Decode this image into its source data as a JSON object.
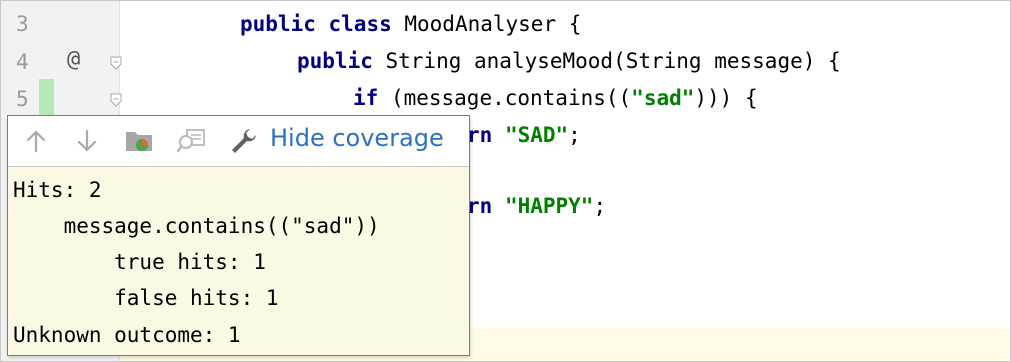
{
  "gutter": {
    "line_numbers": [
      "3",
      "4",
      "5"
    ],
    "override_icon": "@"
  },
  "code": {
    "line3": {
      "kw1": "public",
      "kw2": "class",
      "rest": " MoodAnalyser {"
    },
    "line4": {
      "kw1": "public",
      "rest": " String analyseMood(String message) {"
    },
    "line5": {
      "kw1": "if",
      "rest1": " (message.contains((",
      "str": "\"sad\"",
      "rest2": "))) {"
    },
    "line6": {
      "kw_tail": "rn",
      "str": "\"SAD\"",
      "rest": ";"
    },
    "line8": {
      "kw_tail": "rn",
      "str": "\"HAPPY\"",
      "rest": ";"
    }
  },
  "popup": {
    "toolbar": {
      "up_icon": "arrow-up-icon",
      "down_icon": "arrow-down-icon",
      "folder_icon": "coverage-folder-icon",
      "search_icon": "show-in-coverage-icon",
      "wrench_icon": "wrench-icon",
      "hide_label": "Hide coverage"
    },
    "lines": [
      "Hits: 2",
      "    message.contains((\"sad\"))",
      "        true hits: 1",
      "        false hits: 1",
      "Unknown outcome: 1"
    ]
  },
  "colors": {
    "keyword": "#000080",
    "string": "#008000",
    "link": "#2c71c0",
    "popup_bg": "#fbf8e3",
    "covered_marker": "#b8e8b8"
  }
}
